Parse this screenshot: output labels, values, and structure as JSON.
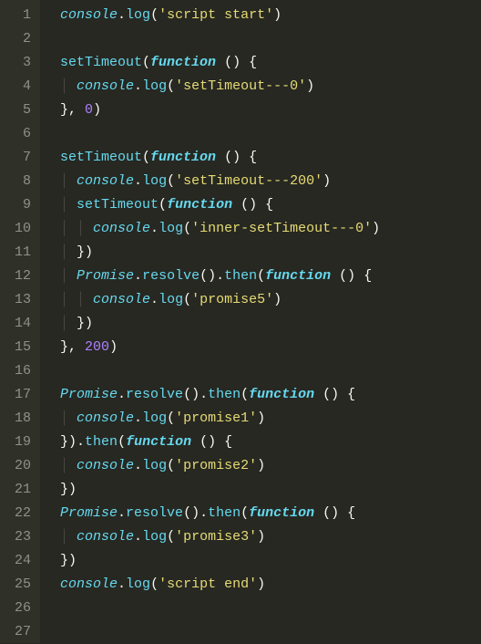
{
  "lines": [
    {
      "n": "1",
      "tokens": [
        [
          "  ",
          "t-ident"
        ],
        [
          "console",
          "t-obj"
        ],
        [
          ".",
          "t-punct"
        ],
        [
          "log",
          "t-call"
        ],
        [
          "(",
          "t-punct"
        ],
        [
          "'script start'",
          "t-string"
        ],
        [
          ")",
          "t-punct"
        ]
      ]
    },
    {
      "n": "2",
      "tokens": []
    },
    {
      "n": "3",
      "tokens": [
        [
          "  ",
          "t-ident"
        ],
        [
          "setTimeout",
          "t-call"
        ],
        [
          "(",
          "t-punct"
        ],
        [
          "function",
          "t-kw"
        ],
        [
          " ",
          "t-ident"
        ],
        [
          "()",
          "t-punct"
        ],
        [
          " ",
          "t-ident"
        ],
        [
          "{",
          "t-brace"
        ]
      ]
    },
    {
      "n": "4",
      "tokens": [
        [
          "  ",
          "t-ident"
        ],
        [
          "│ ",
          "t-guide"
        ],
        [
          "console",
          "t-obj"
        ],
        [
          ".",
          "t-punct"
        ],
        [
          "log",
          "t-call"
        ],
        [
          "(",
          "t-punct"
        ],
        [
          "'setTimeout---0'",
          "t-string"
        ],
        [
          ")",
          "t-punct"
        ]
      ]
    },
    {
      "n": "5",
      "tokens": [
        [
          "  ",
          "t-ident"
        ],
        [
          "}",
          "t-brace"
        ],
        [
          ", ",
          "t-punct"
        ],
        [
          "0",
          "t-num"
        ],
        [
          ")",
          "t-punct"
        ]
      ]
    },
    {
      "n": "6",
      "tokens": []
    },
    {
      "n": "7",
      "tokens": [
        [
          "  ",
          "t-ident"
        ],
        [
          "setTimeout",
          "t-call"
        ],
        [
          "(",
          "t-punct"
        ],
        [
          "function",
          "t-kw"
        ],
        [
          " ",
          "t-ident"
        ],
        [
          "()",
          "t-punct"
        ],
        [
          " ",
          "t-ident"
        ],
        [
          "{",
          "t-brace"
        ]
      ]
    },
    {
      "n": "8",
      "tokens": [
        [
          "  ",
          "t-ident"
        ],
        [
          "│ ",
          "t-guide"
        ],
        [
          "console",
          "t-obj"
        ],
        [
          ".",
          "t-punct"
        ],
        [
          "log",
          "t-call"
        ],
        [
          "(",
          "t-punct"
        ],
        [
          "'setTimeout---200'",
          "t-string"
        ],
        [
          ")",
          "t-punct"
        ]
      ]
    },
    {
      "n": "9",
      "tokens": [
        [
          "  ",
          "t-ident"
        ],
        [
          "│ ",
          "t-guide"
        ],
        [
          "setTimeout",
          "t-call"
        ],
        [
          "(",
          "t-punct"
        ],
        [
          "function",
          "t-kw"
        ],
        [
          " ",
          "t-ident"
        ],
        [
          "()",
          "t-punct"
        ],
        [
          " ",
          "t-ident"
        ],
        [
          "{",
          "t-brace"
        ]
      ]
    },
    {
      "n": "10",
      "tokens": [
        [
          "  ",
          "t-ident"
        ],
        [
          "│ │ ",
          "t-guide"
        ],
        [
          "console",
          "t-obj"
        ],
        [
          ".",
          "t-punct"
        ],
        [
          "log",
          "t-call"
        ],
        [
          "(",
          "t-punct"
        ],
        [
          "'inner-setTimeout---0'",
          "t-string"
        ],
        [
          ")",
          "t-punct"
        ]
      ]
    },
    {
      "n": "11",
      "tokens": [
        [
          "  ",
          "t-ident"
        ],
        [
          "│ ",
          "t-guide"
        ],
        [
          "}",
          "t-brace"
        ],
        [
          ")",
          "t-punct"
        ]
      ]
    },
    {
      "n": "12",
      "tokens": [
        [
          "  ",
          "t-ident"
        ],
        [
          "│ ",
          "t-guide"
        ],
        [
          "Promise",
          "t-obj"
        ],
        [
          ".",
          "t-punct"
        ],
        [
          "resolve",
          "t-call"
        ],
        [
          "().",
          "t-punct"
        ],
        [
          "then",
          "t-call"
        ],
        [
          "(",
          "t-punct"
        ],
        [
          "function",
          "t-kw"
        ],
        [
          " ",
          "t-ident"
        ],
        [
          "()",
          "t-punct"
        ],
        [
          " ",
          "t-ident"
        ],
        [
          "{",
          "t-brace"
        ]
      ]
    },
    {
      "n": "13",
      "tokens": [
        [
          "  ",
          "t-ident"
        ],
        [
          "│ │ ",
          "t-guide"
        ],
        [
          "console",
          "t-obj"
        ],
        [
          ".",
          "t-punct"
        ],
        [
          "log",
          "t-call"
        ],
        [
          "(",
          "t-punct"
        ],
        [
          "'promise5'",
          "t-string"
        ],
        [
          ")",
          "t-punct"
        ]
      ]
    },
    {
      "n": "14",
      "tokens": [
        [
          "  ",
          "t-ident"
        ],
        [
          "│ ",
          "t-guide"
        ],
        [
          "}",
          "t-brace"
        ],
        [
          ")",
          "t-punct"
        ]
      ]
    },
    {
      "n": "15",
      "tokens": [
        [
          "  ",
          "t-ident"
        ],
        [
          "}",
          "t-brace"
        ],
        [
          ", ",
          "t-punct"
        ],
        [
          "200",
          "t-num"
        ],
        [
          ")",
          "t-punct"
        ]
      ]
    },
    {
      "n": "16",
      "tokens": []
    },
    {
      "n": "17",
      "tokens": [
        [
          "  ",
          "t-ident"
        ],
        [
          "Promise",
          "t-obj"
        ],
        [
          ".",
          "t-punct"
        ],
        [
          "resolve",
          "t-call"
        ],
        [
          "().",
          "t-punct"
        ],
        [
          "then",
          "t-call"
        ],
        [
          "(",
          "t-punct"
        ],
        [
          "function",
          "t-kw"
        ],
        [
          " ",
          "t-ident"
        ],
        [
          "()",
          "t-punct"
        ],
        [
          " ",
          "t-ident"
        ],
        [
          "{",
          "t-brace"
        ]
      ]
    },
    {
      "n": "18",
      "tokens": [
        [
          "  ",
          "t-ident"
        ],
        [
          "│ ",
          "t-guide"
        ],
        [
          "console",
          "t-obj"
        ],
        [
          ".",
          "t-punct"
        ],
        [
          "log",
          "t-call"
        ],
        [
          "(",
          "t-punct"
        ],
        [
          "'promise1'",
          "t-string"
        ],
        [
          ")",
          "t-punct"
        ]
      ]
    },
    {
      "n": "19",
      "tokens": [
        [
          "  ",
          "t-ident"
        ],
        [
          "}",
          "t-brace"
        ],
        [
          ").",
          "t-punct"
        ],
        [
          "then",
          "t-call"
        ],
        [
          "(",
          "t-punct"
        ],
        [
          "function",
          "t-kw"
        ],
        [
          " ",
          "t-ident"
        ],
        [
          "()",
          "t-punct"
        ],
        [
          " ",
          "t-ident"
        ],
        [
          "{",
          "t-brace"
        ]
      ]
    },
    {
      "n": "20",
      "tokens": [
        [
          "  ",
          "t-ident"
        ],
        [
          "│ ",
          "t-guide"
        ],
        [
          "console",
          "t-obj"
        ],
        [
          ".",
          "t-punct"
        ],
        [
          "log",
          "t-call"
        ],
        [
          "(",
          "t-punct"
        ],
        [
          "'promise2'",
          "t-string"
        ],
        [
          ")",
          "t-punct"
        ]
      ]
    },
    {
      "n": "21",
      "tokens": [
        [
          "  ",
          "t-ident"
        ],
        [
          "}",
          "t-brace"
        ],
        [
          ")",
          "t-punct"
        ]
      ]
    },
    {
      "n": "22",
      "tokens": [
        [
          "  ",
          "t-ident"
        ],
        [
          "Promise",
          "t-obj"
        ],
        [
          ".",
          "t-punct"
        ],
        [
          "resolve",
          "t-call"
        ],
        [
          "().",
          "t-punct"
        ],
        [
          "then",
          "t-call"
        ],
        [
          "(",
          "t-punct"
        ],
        [
          "function",
          "t-kw"
        ],
        [
          " ",
          "t-ident"
        ],
        [
          "()",
          "t-punct"
        ],
        [
          " ",
          "t-ident"
        ],
        [
          "{",
          "t-brace"
        ]
      ]
    },
    {
      "n": "23",
      "tokens": [
        [
          "  ",
          "t-ident"
        ],
        [
          "│ ",
          "t-guide"
        ],
        [
          "console",
          "t-obj"
        ],
        [
          ".",
          "t-punct"
        ],
        [
          "log",
          "t-call"
        ],
        [
          "(",
          "t-punct"
        ],
        [
          "'promise3'",
          "t-string"
        ],
        [
          ")",
          "t-punct"
        ]
      ]
    },
    {
      "n": "24",
      "tokens": [
        [
          "  ",
          "t-ident"
        ],
        [
          "}",
          "t-brace"
        ],
        [
          ")",
          "t-punct"
        ]
      ]
    },
    {
      "n": "25",
      "tokens": [
        [
          "  ",
          "t-ident"
        ],
        [
          "console",
          "t-obj"
        ],
        [
          ".",
          "t-punct"
        ],
        [
          "log",
          "t-call"
        ],
        [
          "(",
          "t-punct"
        ],
        [
          "'script end'",
          "t-string"
        ],
        [
          ")",
          "t-punct"
        ]
      ]
    },
    {
      "n": "26",
      "tokens": []
    },
    {
      "n": "27",
      "tokens": []
    }
  ]
}
